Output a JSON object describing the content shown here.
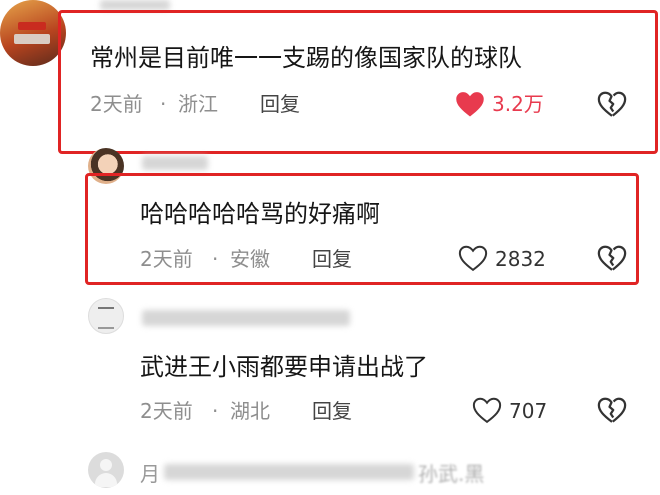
{
  "comments": [
    {
      "text": "常州是目前唯一一支踢的像国家队的球队",
      "time": "2天前",
      "dot": "·",
      "location": "浙江",
      "reply_label": "回复",
      "likes": "3.2万",
      "liked": true
    },
    {
      "text": "哈哈哈哈哈骂的好痛啊",
      "time": "2天前",
      "dot": "·",
      "location": "安徽",
      "reply_label": "回复",
      "likes": "2832",
      "liked": false
    },
    {
      "text": "武进王小雨都要申请出战了",
      "time": "2天前",
      "dot": "·",
      "location": "湖北",
      "reply_label": "回复",
      "likes": "707",
      "liked": false
    }
  ],
  "partial_username_4": "月",
  "partial_text_4": "孙武.黑",
  "colors": {
    "highlight_border": "#e02424",
    "liked_heart": "#e83a4e",
    "meta_text": "#8e8e8e"
  }
}
